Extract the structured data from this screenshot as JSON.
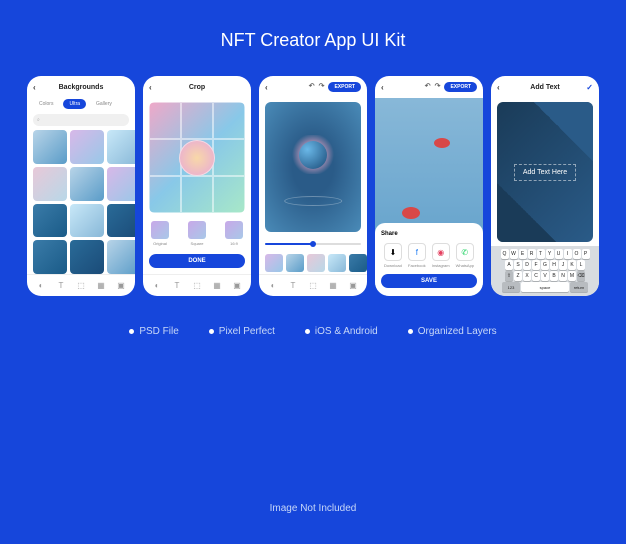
{
  "title": "NFT Creator App UI Kit",
  "screens": {
    "backgrounds": {
      "title": "Backgrounds",
      "tabs": [
        "Colors",
        "Ultra",
        "Gallery"
      ],
      "search_placeholder": "Search"
    },
    "crop": {
      "title": "Crop",
      "ratios": [
        "Original",
        "Square",
        "16:9"
      ],
      "done": "DONE"
    },
    "preview": {
      "export": "EXPORT"
    },
    "share": {
      "export": "EXPORT",
      "panel_title": "Share",
      "options": [
        "Download",
        "Facebook",
        "Instagram",
        "WhatsApp"
      ],
      "save": "SAVE"
    },
    "text": {
      "title": "Add Text",
      "placeholder": "Add Text Here",
      "keyboard": {
        "row1": [
          "Q",
          "W",
          "E",
          "R",
          "T",
          "Y",
          "U",
          "I",
          "O",
          "P"
        ],
        "row2": [
          "A",
          "S",
          "D",
          "F",
          "G",
          "H",
          "J",
          "K",
          "L"
        ],
        "row3": [
          "Z",
          "X",
          "C",
          "V",
          "B",
          "N",
          "M"
        ],
        "space": "space",
        "return": "return"
      }
    }
  },
  "features": [
    "PSD File",
    "Pixel Perfect",
    "iOS & Android",
    "Organized Layers"
  ],
  "disclaimer": "Image Not Included"
}
